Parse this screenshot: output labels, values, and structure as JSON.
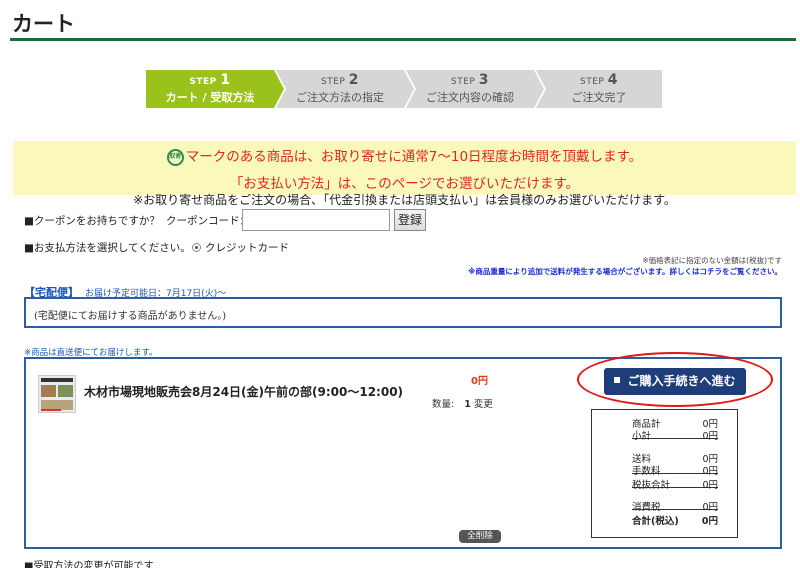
{
  "page": {
    "title": "カート"
  },
  "steps": [
    {
      "prefix": "STEP",
      "num": "1",
      "label": "カート / 受取方法",
      "active": true
    },
    {
      "prefix": "STEP",
      "num": "2",
      "label": "ご注文方法の指定",
      "active": false
    },
    {
      "prefix": "STEP",
      "num": "3",
      "label": "ご注文内容の確認",
      "active": false
    },
    {
      "prefix": "STEP",
      "num": "4",
      "label": "ご注文完了",
      "active": false
    }
  ],
  "notice": {
    "icon_text": "取寄",
    "line1": "マークのある商品は、お取り寄せに通常7～10日程度お時間を頂戴します。",
    "line2": "「お支払い方法」は、このページでお選びいただけます。",
    "line3": "※お取り寄せ商品をご注文の場合、「代金引換または店頭支払い」は会員様のみお選びいただけます。"
  },
  "coupon": {
    "question": "■クーポンをお持ちですか？",
    "code_label": "クーポンコード：",
    "input_value": "",
    "register_label": "登録"
  },
  "payment": {
    "prompt": "■お支払方法を選択してください。",
    "option": "クレジットカード"
  },
  "notes": {
    "price_note": "※価格表記に指定のない金額は(税抜)です",
    "shipping_note": "※商品重量により追加で送料が発生する場合がございます。詳しくはコチラをご覧ください。"
  },
  "delivery": {
    "label": "【宅配便】",
    "date": "お届け予定可能日：7月17日(火)～",
    "empty_message": "(宅配便にてお届けする商品がありません。)"
  },
  "direct": {
    "note": "※商品は直送便にてお届けします。",
    "product_name": "木材市場現地販売会8月24日(金)午前の部(9:00～12:00)",
    "price": "0円",
    "qty_label": "数量:",
    "qty_value": "1",
    "change_label": "変更",
    "purchase_label": "ご購入手続きへ進む",
    "clear_label": "全削除"
  },
  "totals": [
    {
      "key": "商品計",
      "value": "0円",
      "ul": false,
      "bold": false
    },
    {
      "key": "小計",
      "value": "0円",
      "ul": true,
      "bold": false
    },
    {
      "key": "送料",
      "value": "0円",
      "ul": false,
      "bold": false
    },
    {
      "key": "手数料",
      "value": "0円",
      "ul": true,
      "bold": false
    },
    {
      "key": "税抜合計",
      "value": "0円",
      "ul": true,
      "bold": false
    },
    {
      "key": "消費税",
      "value": "0円",
      "ul": true,
      "bold": false
    },
    {
      "key": "合計(税込)",
      "value": "0円",
      "ul": false,
      "bold": true
    }
  ],
  "bottom": {
    "text": "■受取方法の変更が可能です"
  }
}
